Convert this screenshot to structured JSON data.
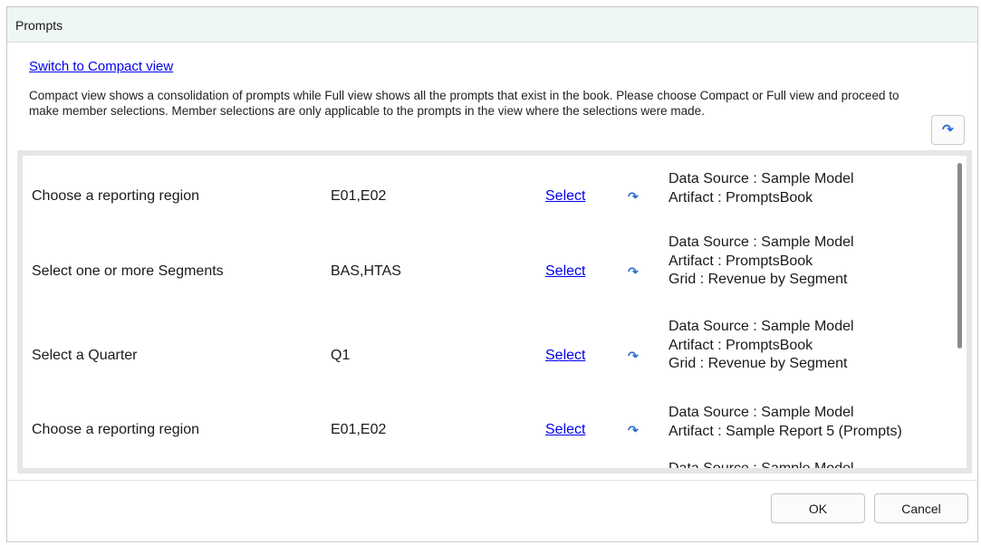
{
  "dialog": {
    "title": "Prompts",
    "switch_link": "Switch to Compact view",
    "description": "Compact view shows a consolidation of prompts while Full view shows all the prompts that exist in the book. Please choose Compact or Full view and proceed to make member selections. Member selections are only applicable to the prompts in the view where the selections were made.",
    "reset_all_icon": "reset-icon"
  },
  "prompts": [
    {
      "label": "Choose a reporting region",
      "value": "E01,E02",
      "select": "Select",
      "meta": [
        "Data Source : Sample Model",
        "Artifact : PromptsBook"
      ]
    },
    {
      "label": "Select one or more Segments",
      "value": "BAS,HTAS",
      "select": "Select",
      "meta": [
        "Data Source : Sample Model",
        "Artifact : PromptsBook",
        "Grid : Revenue by Segment"
      ]
    },
    {
      "label": "Select a Quarter",
      "value": "Q1",
      "select": "Select",
      "meta": [
        "Data Source : Sample Model",
        "Artifact : PromptsBook",
        "Grid : Revenue by Segment"
      ]
    },
    {
      "label": "Choose a reporting region",
      "value": "E01,E02",
      "select": "Select",
      "meta": [
        "Data Source : Sample Model",
        "Artifact : Sample Report 5 (Prompts)"
      ]
    },
    {
      "label": "",
      "value": "",
      "select": "",
      "meta": [
        "Data Source : Sample Model"
      ]
    }
  ],
  "footer": {
    "ok_label": "OK",
    "cancel_label": "Cancel"
  },
  "colors": {
    "title_bar": "#eef7f4",
    "link": "#0000ee",
    "reset_icon": "#2f6fd6"
  }
}
